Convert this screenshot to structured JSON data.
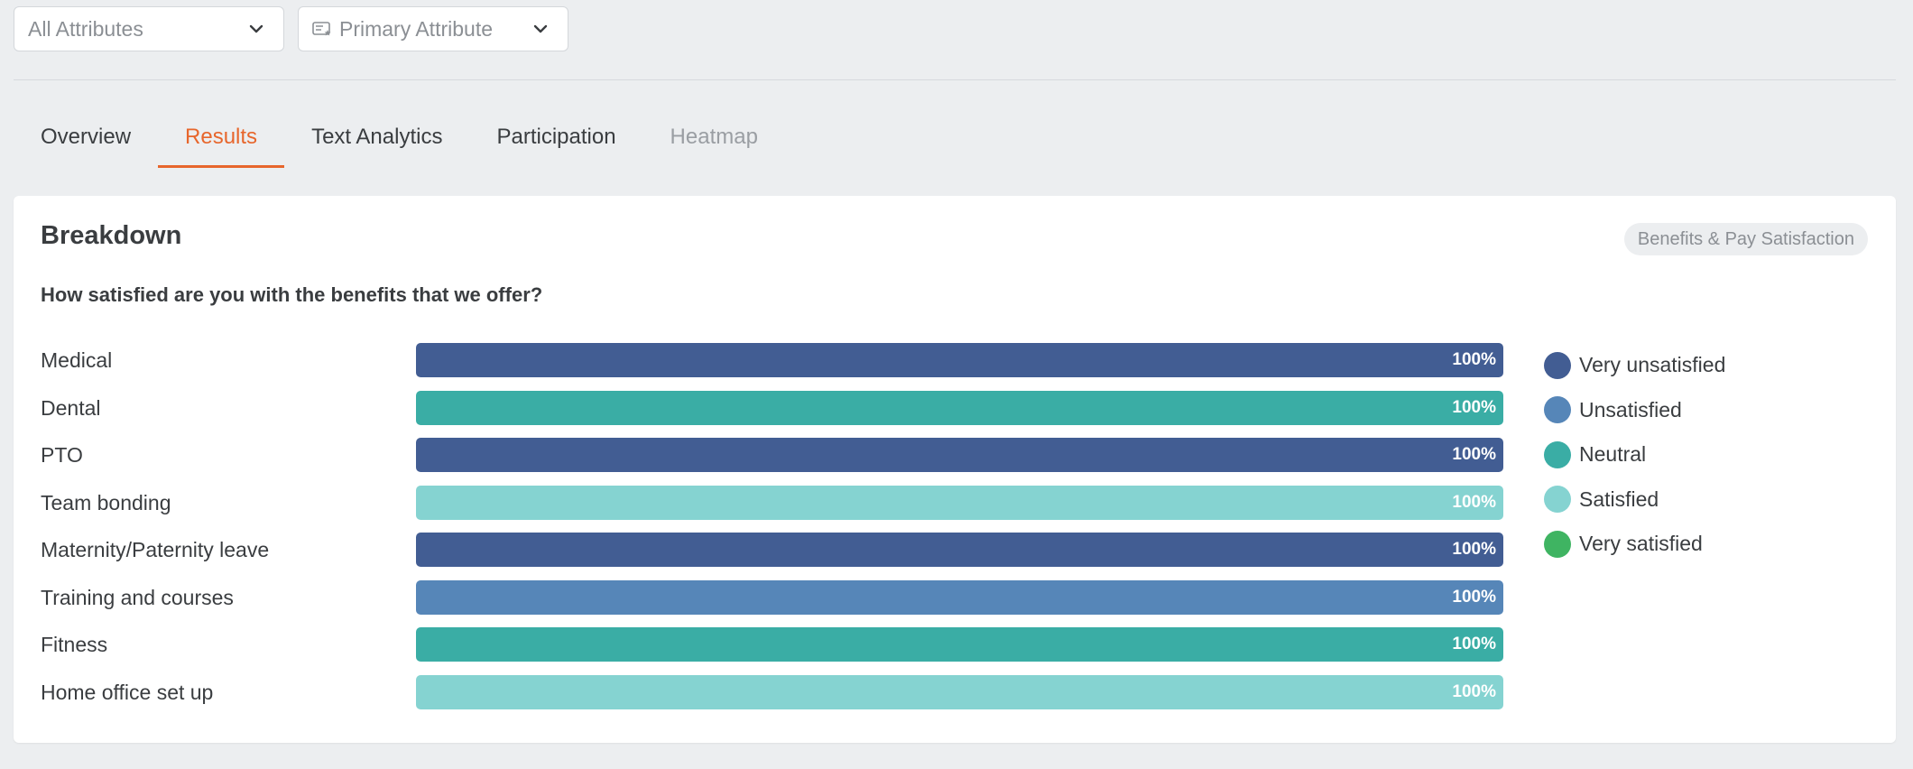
{
  "filters": {
    "attributes": {
      "label": "All Attributes"
    },
    "primary": {
      "label": "Primary Attribute"
    }
  },
  "tabs": [
    {
      "label": "Overview",
      "state": "default"
    },
    {
      "label": "Results",
      "state": "active"
    },
    {
      "label": "Text Analytics",
      "state": "default"
    },
    {
      "label": "Participation",
      "state": "default"
    },
    {
      "label": "Heatmap",
      "state": "disabled"
    }
  ],
  "card": {
    "title": "Breakdown",
    "tag": "Benefits & Pay Satisfaction",
    "question": "How satisfied are you with the benefits that we offer?"
  },
  "colors": {
    "Very unsatisfied": "#425d93",
    "Unsatisfied": "#5686b8",
    "Neutral": "#3aada5",
    "Satisfied": "#85d3d1",
    "Very satisfied": "#3fb462"
  },
  "chart_data": {
    "type": "bar",
    "orientation": "horizontal",
    "categories": [
      "Medical",
      "Dental",
      "PTO",
      "Team bonding",
      "Maternity/Paternity leave",
      "Training and courses",
      "Fitness",
      "Home office set up"
    ],
    "series": [
      {
        "category": "Medical",
        "segment": "Very unsatisfied",
        "value": 100,
        "label": "100%"
      },
      {
        "category": "Dental",
        "segment": "Neutral",
        "value": 100,
        "label": "100%"
      },
      {
        "category": "PTO",
        "segment": "Very unsatisfied",
        "value": 100,
        "label": "100%"
      },
      {
        "category": "Team bonding",
        "segment": "Satisfied",
        "value": 100,
        "label": "100%"
      },
      {
        "category": "Maternity/Paternity leave",
        "segment": "Very unsatisfied",
        "value": 100,
        "label": "100%"
      },
      {
        "category": "Training and courses",
        "segment": "Unsatisfied",
        "value": 100,
        "label": "100%"
      },
      {
        "category": "Fitness",
        "segment": "Neutral",
        "value": 100,
        "label": "100%"
      },
      {
        "category": "Home office set up",
        "segment": "Satisfied",
        "value": 100,
        "label": "100%"
      }
    ],
    "xlim": [
      0,
      100
    ],
    "legend": [
      "Very unsatisfied",
      "Unsatisfied",
      "Neutral",
      "Satisfied",
      "Very satisfied"
    ],
    "legend_position": "right"
  }
}
